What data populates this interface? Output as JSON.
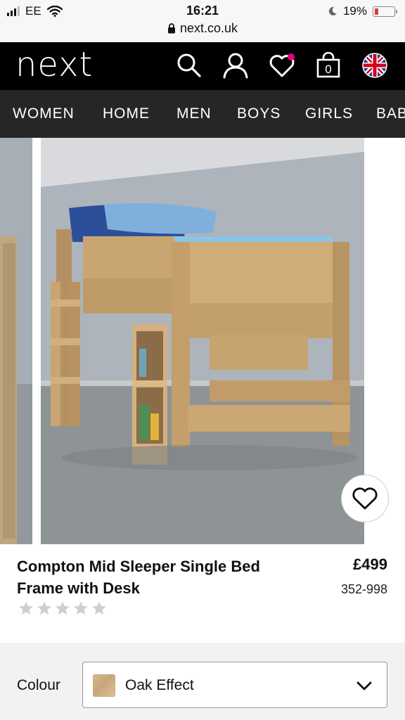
{
  "status_bar": {
    "carrier": "EE",
    "time": "16:21",
    "battery": "19%",
    "battery_level": 0.19,
    "url": "next.co.uk"
  },
  "header": {
    "logo": "next",
    "bag_count": "0"
  },
  "nav": {
    "items": [
      "WOMEN",
      "HOME",
      "MEN",
      "BOYS",
      "GIRLS",
      "BABY"
    ]
  },
  "product": {
    "title": "Compton Mid Sleeper Single Bed Frame with Desk",
    "price": "£499",
    "code": "352-998",
    "rating": 0,
    "rating_max": 5
  },
  "colour": {
    "label": "Colour",
    "selected": "Oak Effect",
    "swatch_color": "#d2b185"
  },
  "colors": {
    "header_bg": "#000000",
    "nav_bg": "#262626",
    "wishlist_dot": "#e6007e",
    "battery_low": "#e53935"
  }
}
